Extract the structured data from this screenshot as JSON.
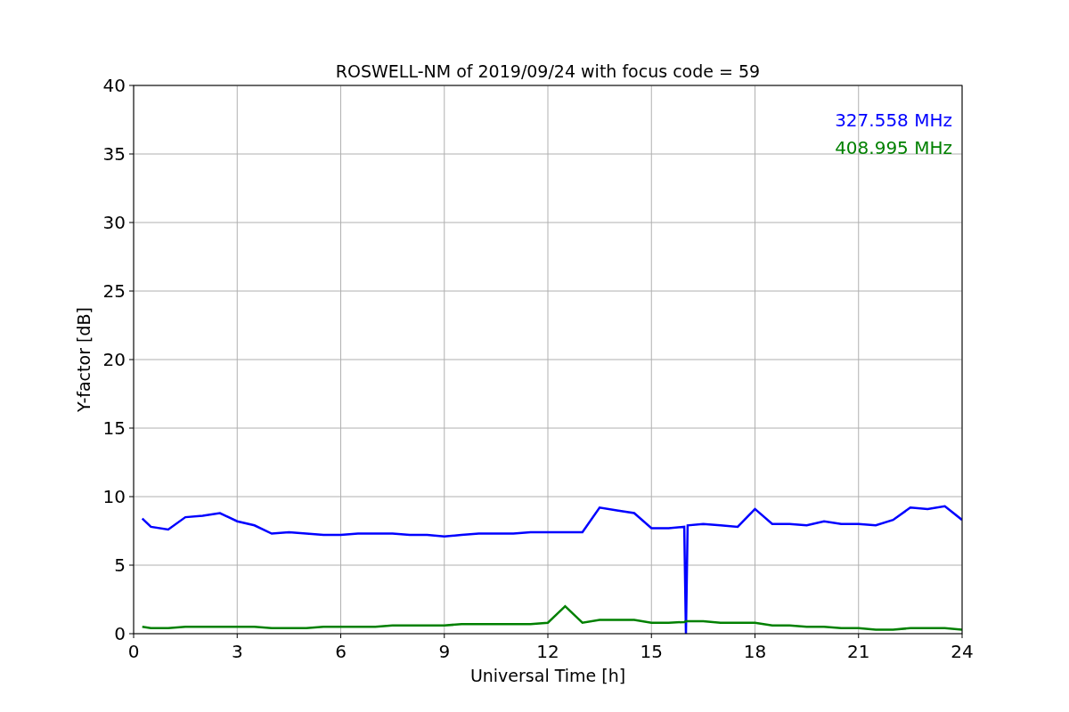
{
  "figure": {
    "chart_data": {
      "type": "line",
      "title": "ROSWELL-NM of 2019/09/24 with focus code = 59",
      "xlabel": "Universal Time [h]",
      "ylabel": "Y-factor [dB]",
      "x": [
        0.25,
        0.5,
        1,
        1.5,
        2,
        2.5,
        3,
        3.5,
        4,
        4.5,
        5,
        5.5,
        6,
        6.5,
        7,
        7.5,
        8,
        8.5,
        9,
        9.5,
        10,
        10.5,
        11,
        11.5,
        12,
        12.5,
        13,
        13.5,
        14,
        14.5,
        15,
        15.5,
        15.95,
        16,
        16.05,
        16.5,
        17,
        17.5,
        18,
        18.5,
        19,
        19.5,
        20,
        20.5,
        21,
        21.5,
        22,
        22.5,
        23,
        23.5,
        24
      ],
      "series": [
        {
          "name": "327.558 MHz",
          "color": "#0000ff",
          "values": [
            8.4,
            7.8,
            7.6,
            8.5,
            8.6,
            8.8,
            8.2,
            7.9,
            7.3,
            7.4,
            7.3,
            7.2,
            7.2,
            7.3,
            7.3,
            7.3,
            7.2,
            7.2,
            7.1,
            7.2,
            7.3,
            7.3,
            7.3,
            7.4,
            7.4,
            7.4,
            7.4,
            9.2,
            9.0,
            8.8,
            7.7,
            7.7,
            7.8,
            0,
            7.9,
            8.0,
            7.9,
            7.8,
            9.1,
            8.0,
            8.0,
            7.9,
            8.2,
            8.0,
            8.0,
            7.9,
            8.3,
            9.2,
            9.1,
            9.3,
            8.3
          ]
        },
        {
          "name": "408.995 MHz",
          "color": "#008000",
          "values": [
            0.5,
            0.4,
            0.4,
            0.5,
            0.5,
            0.5,
            0.5,
            0.5,
            0.4,
            0.4,
            0.4,
            0.5,
            0.5,
            0.5,
            0.5,
            0.6,
            0.6,
            0.6,
            0.6,
            0.7,
            0.7,
            0.7,
            0.7,
            0.7,
            0.8,
            2.0,
            0.8,
            1.0,
            1.0,
            1.0,
            0.8,
            0.8,
            0.85,
            0.9,
            0.9,
            0.9,
            0.8,
            0.8,
            0.8,
            0.6,
            0.6,
            0.5,
            0.5,
            0.4,
            0.4,
            0.3,
            0.3,
            0.4,
            0.4,
            0.4,
            0.3
          ]
        }
      ],
      "xlim": [
        0,
        24
      ],
      "ylim": [
        0,
        40
      ],
      "xticks": [
        0,
        3,
        6,
        9,
        12,
        15,
        18,
        21,
        24
      ],
      "yticks": [
        0,
        5,
        10,
        15,
        20,
        25,
        30,
        35,
        40
      ],
      "grid": true
    }
  }
}
